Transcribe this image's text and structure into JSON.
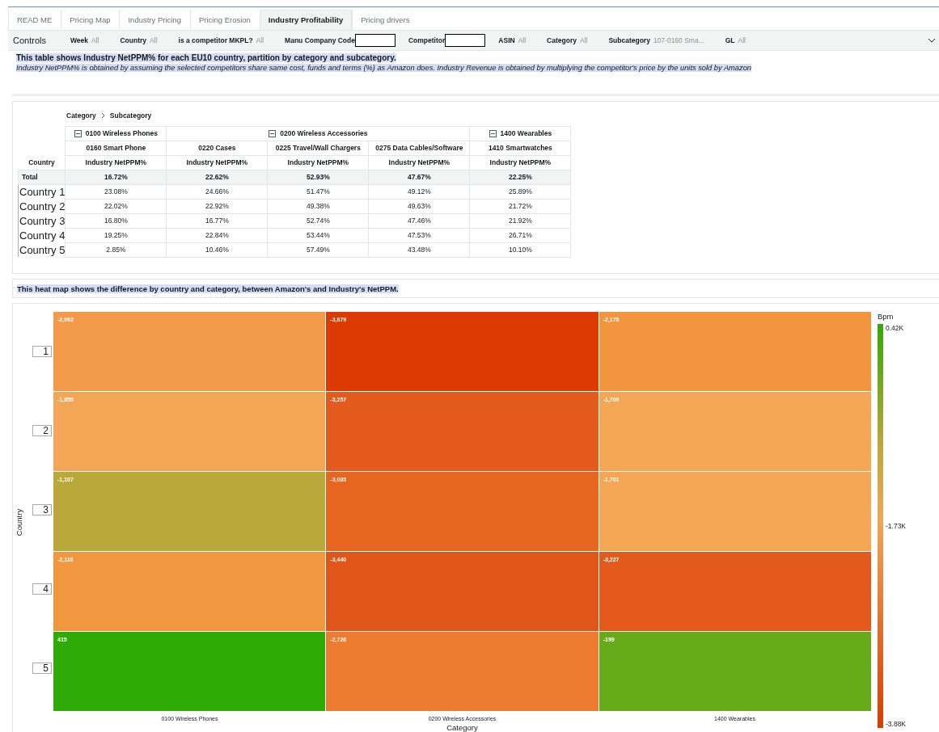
{
  "tabs": [
    {
      "label": "READ ME",
      "selected": false
    },
    {
      "label": "Pricing Map",
      "selected": false
    },
    {
      "label": "Industry Pricing",
      "selected": false
    },
    {
      "label": "Pricing Erosion",
      "selected": false
    },
    {
      "label": "Industry Profitability",
      "selected": true
    },
    {
      "label": "Pricing drivers",
      "selected": false
    }
  ],
  "controls": {
    "title": "Controls",
    "filters": [
      {
        "kind": "value",
        "label": "Week",
        "value": "All"
      },
      {
        "kind": "value",
        "label": "Country",
        "value": "All"
      },
      {
        "kind": "value",
        "label": "is a competitor MKPL?",
        "value": "All"
      },
      {
        "kind": "input",
        "label": "Manu Company Code"
      },
      {
        "kind": "input",
        "label": "Competitor"
      },
      {
        "kind": "value",
        "label": "ASIN",
        "value": "All"
      },
      {
        "kind": "value",
        "label": "Category",
        "value": "All"
      },
      {
        "kind": "value",
        "label": "Subcategory",
        "value": "107-0160 Sma..."
      },
      {
        "kind": "value",
        "label": "GL",
        "value": "All"
      }
    ]
  },
  "description": {
    "heading": "This table shows Industry NetPPM% for each EU10 country, partition by category and subcategory.",
    "note": "Industry NetPPM% is obtained by assuming the selected competitors share same cost, funds and terms (%) as Amazon does. Industry Revenue is obtained by multiplying the competitor's price by the units sold by Amazon"
  },
  "table": {
    "breadcrumb": [
      "Category",
      "Subcategory"
    ],
    "row_header": "Country",
    "categories": [
      {
        "label": "0100 Wireless Phones",
        "expanded": true,
        "subcategories": [
          "0160 Smart Phone"
        ]
      },
      {
        "label": "0200 Wireless Accessories",
        "expanded": true,
        "subcategories": [
          "0220 Cases",
          "0225 Travel/Wall Chargers",
          "0275 Data Cables/Software"
        ]
      },
      {
        "label": "1400 Wearables",
        "expanded": true,
        "subcategories": [
          "1410 Smartwatches"
        ]
      }
    ],
    "measures": [
      "Industry NetPPM%",
      "Industry NetPPM%",
      "Industry NetPPM%",
      "Industry NetPPM%",
      "Industry NetPPM%"
    ],
    "total": {
      "label": "Total",
      "values": [
        "16.72%",
        "22.62%",
        "52.93%",
        "47.67%",
        "22.25%"
      ]
    },
    "rows": [
      {
        "country": "Country 1",
        "values": [
          "23.08%",
          "24.66%",
          "51.47%",
          "49.12%",
          "25.89%"
        ]
      },
      {
        "country": "Country 2",
        "values": [
          "22.02%",
          "22.92%",
          "49.38%",
          "49.63%",
          "21.72%"
        ]
      },
      {
        "country": "Country 3",
        "values": [
          "16.80%",
          "16.77%",
          "52.74%",
          "47.46%",
          "21.92%"
        ]
      },
      {
        "country": "Country 4",
        "values": [
          "19.25%",
          "22.84%",
          "53.44%",
          "47.53%",
          "26.71%"
        ]
      },
      {
        "country": "Country 5",
        "values": [
          "2.85%",
          "10.46%",
          "57.49%",
          "43.48%",
          "10.10%"
        ]
      }
    ]
  },
  "heatmap_caption": "This heat map shows the difference by country and category, between Amazon's and Industry's NetPPM.",
  "heatmap": {
    "y_title": "Country",
    "x_title": "Category",
    "columns": [
      "0100 Wireless Phones",
      "0200 Wireless Accessories",
      "1400 Wearables"
    ],
    "countries": [
      {
        "label": "1",
        "tiles": [
          {
            "value": "-2,062",
            "color": "#f29a4a"
          },
          {
            "value": "-3,879",
            "color": "#dc3a00"
          },
          {
            "value": "-2,178",
            "color": "#f1963f"
          }
        ]
      },
      {
        "label": "2",
        "tiles": [
          {
            "value": "-1,850",
            "color": "#f3a656"
          },
          {
            "value": "-3,257",
            "color": "#e35a1c"
          },
          {
            "value": "-1,709",
            "color": "#f3a755"
          }
        ]
      },
      {
        "label": "3",
        "tiles": [
          {
            "value": "-1,107",
            "color": "#bba83a"
          },
          {
            "value": "-3,085",
            "color": "#e6661f"
          },
          {
            "value": "-1,701",
            "color": "#f3a755"
          }
        ]
      },
      {
        "label": "4",
        "tiles": [
          {
            "value": "-2,118",
            "color": "#f1973f"
          },
          {
            "value": "-3,440",
            "color": "#e05519"
          },
          {
            "value": "-3,227",
            "color": "#e35a1c"
          }
        ]
      },
      {
        "label": "5",
        "tiles": [
          {
            "value": "415",
            "color": "#2eab06"
          },
          {
            "value": "-2,726",
            "color": "#ed7c30"
          },
          {
            "value": "-199",
            "color": "#67ab1a"
          }
        ]
      }
    ],
    "legend": {
      "title": "Bpm",
      "max": "0.42K",
      "mid": "-1.73K",
      "min": "-3.88K"
    }
  }
}
